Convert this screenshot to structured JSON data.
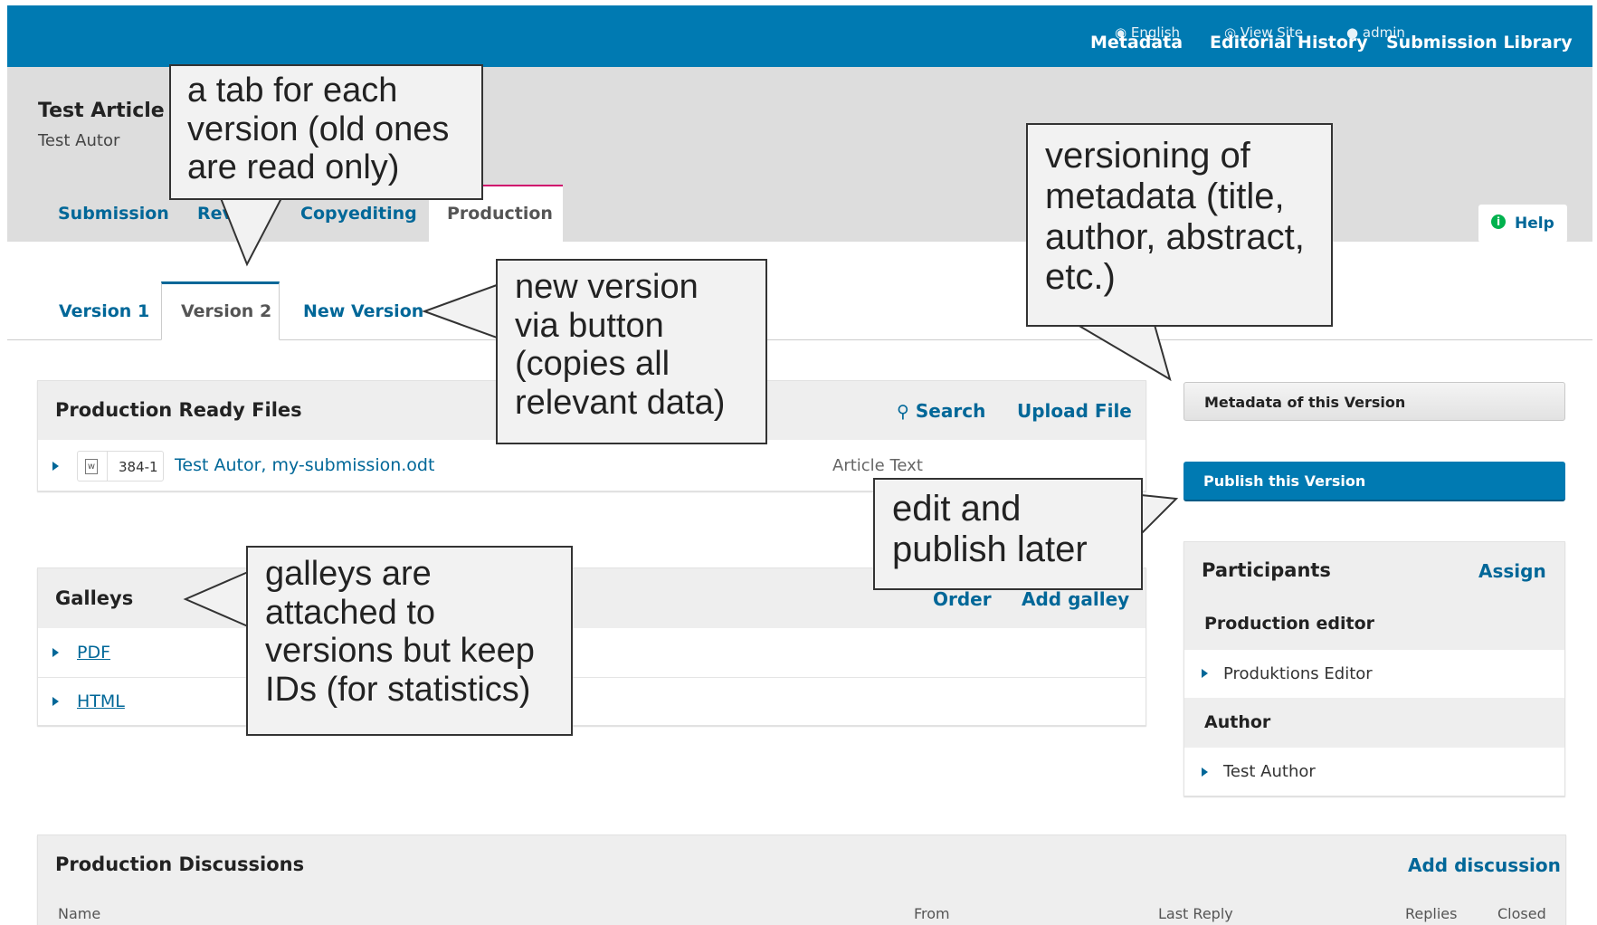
{
  "topbar": {
    "nav": [
      "Metadata",
      "Editorial History",
      "Submission Library"
    ],
    "utility": {
      "language": "English",
      "view_site": "View Site",
      "user": "admin"
    },
    "color": "#007ab2"
  },
  "submission": {
    "title": "Test Article",
    "author": "Test Autor"
  },
  "stage_tabs": [
    "Submission",
    "Review",
    "Copyediting",
    "Production"
  ],
  "help_label": "Help",
  "version_tabs": [
    "Version 1",
    "Version 2",
    "New Version"
  ],
  "production_files": {
    "title": "Production Ready Files",
    "search_label": "Search",
    "upload_label": "Upload File",
    "file": {
      "id": "384-1",
      "name": "Test Autor, my-submission.odt",
      "type": "Article Text"
    }
  },
  "galleys": {
    "title": "Galleys",
    "order_label": "Order",
    "add_label": "Add galley",
    "items": [
      "PDF",
      "HTML"
    ]
  },
  "sidebar": {
    "metadata_button": "Metadata of this Version",
    "publish_button": "Publish this Version",
    "participants": {
      "title": "Participants",
      "assign_label": "Assign",
      "groups": [
        {
          "role": "Production editor",
          "member": "Produktions Editor"
        },
        {
          "role": "Author",
          "member": "Test Author"
        }
      ]
    }
  },
  "discussions": {
    "title": "Production Discussions",
    "add_label": "Add discussion",
    "columns": [
      "Name",
      "From",
      "Last Reply",
      "Replies",
      "Closed"
    ]
  },
  "callouts": {
    "tabs": "a tab for each\nversion (old ones\nare read only)",
    "metadata": "versioning of\nmetadata (title,\nauthor, abstract,\netc.)",
    "new_version": "new version\nvia button\n(copies all\nrelevant data)",
    "publish": "edit and\npublish later",
    "galleys": "galleys are\nattached to\nversions but keep\nIDs (for statistics)"
  }
}
